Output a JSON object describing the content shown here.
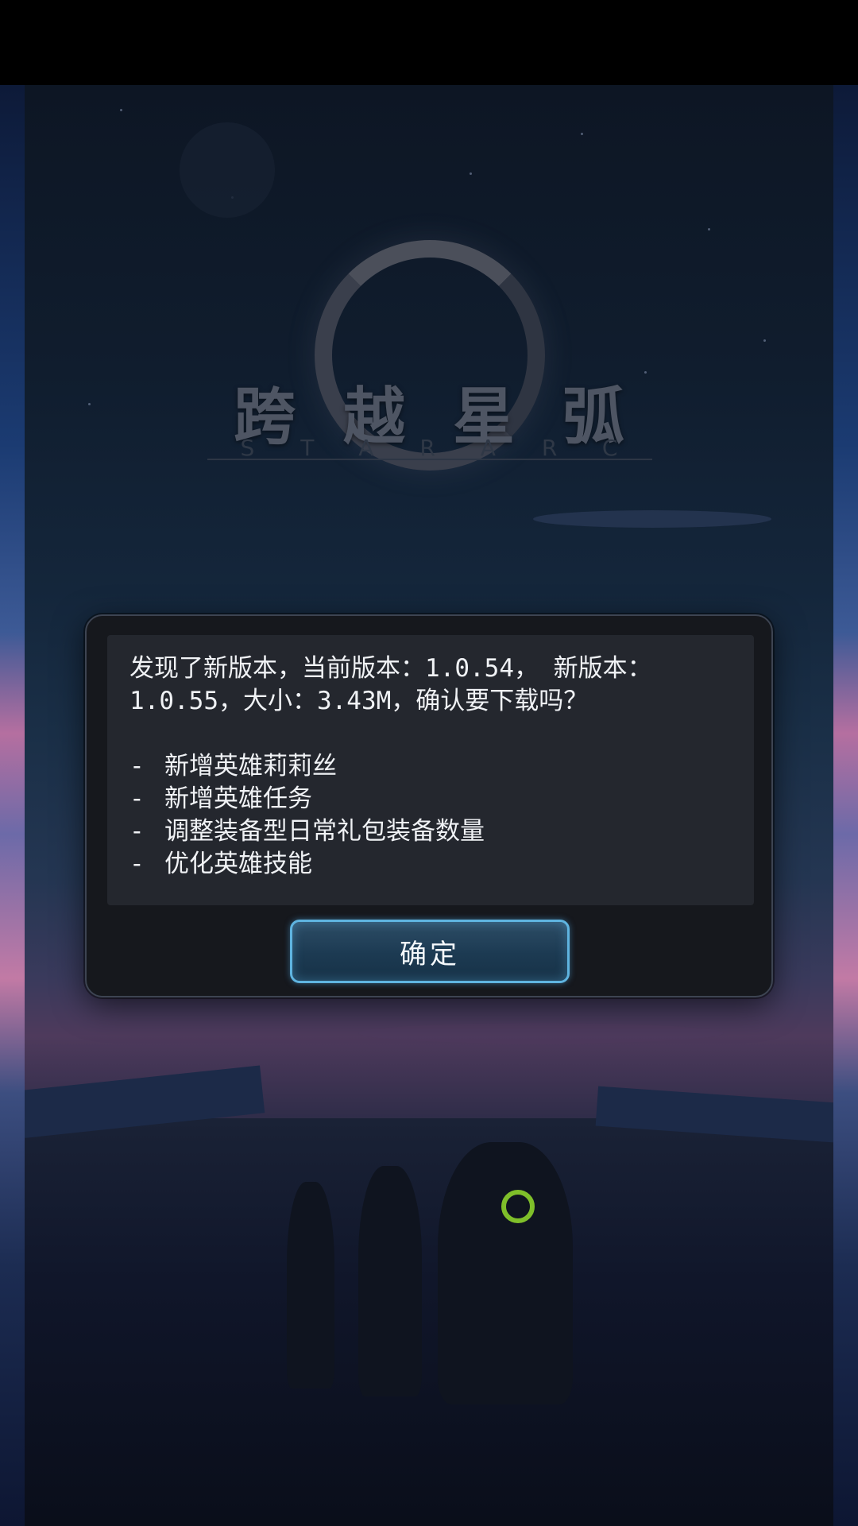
{
  "logo": {
    "title": "跨越星弧",
    "subtitle": "STARARC"
  },
  "dialog": {
    "message": "发现了新版本，当前版本：1.0.54， 新版本：1.0.55，大小：3.43M，确认要下载吗？",
    "changes": [
      "新增英雄莉莉丝",
      "新增英雄任务",
      "调整装备型日常礼包装备数量",
      "优化英雄技能"
    ],
    "confirm_label": "确定",
    "accent_color": "#5fb4e0"
  }
}
